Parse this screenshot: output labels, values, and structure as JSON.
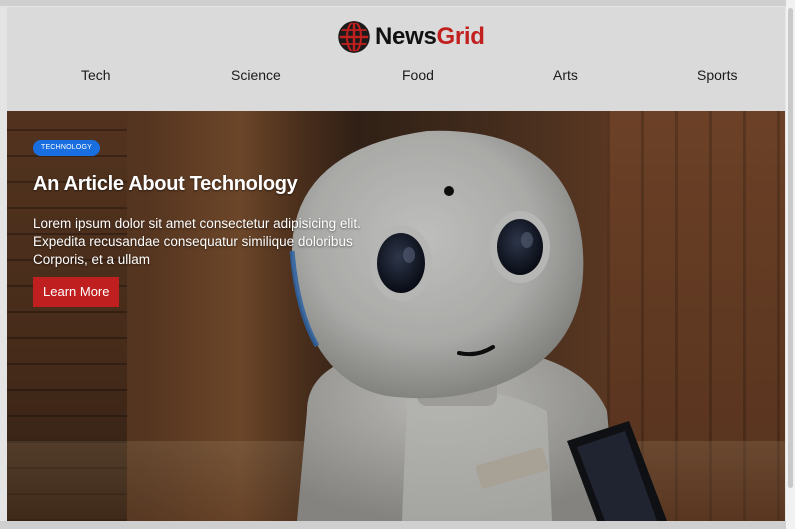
{
  "brand": {
    "name_part1": "News",
    "name_part2": "Grid",
    "logo_icon": "globe-icon",
    "accent": "#c21f1f"
  },
  "nav": {
    "items": [
      {
        "label": "Tech"
      },
      {
        "label": "Science"
      },
      {
        "label": "Food"
      },
      {
        "label": "Arts"
      },
      {
        "label": "Sports"
      }
    ]
  },
  "hero": {
    "badge": "TECHNOLOGY",
    "badge_color": "#1a6fe0",
    "title": "An Article About Technology",
    "body": "Lorem ipsum dolor sit amet consectetur adipisicing elit. Expedita recusandae consequatur similique doloribus Corporis, et a ullam",
    "button_label": "Learn More",
    "button_color": "#c01f1f",
    "image_alt": "robot-photo"
  }
}
